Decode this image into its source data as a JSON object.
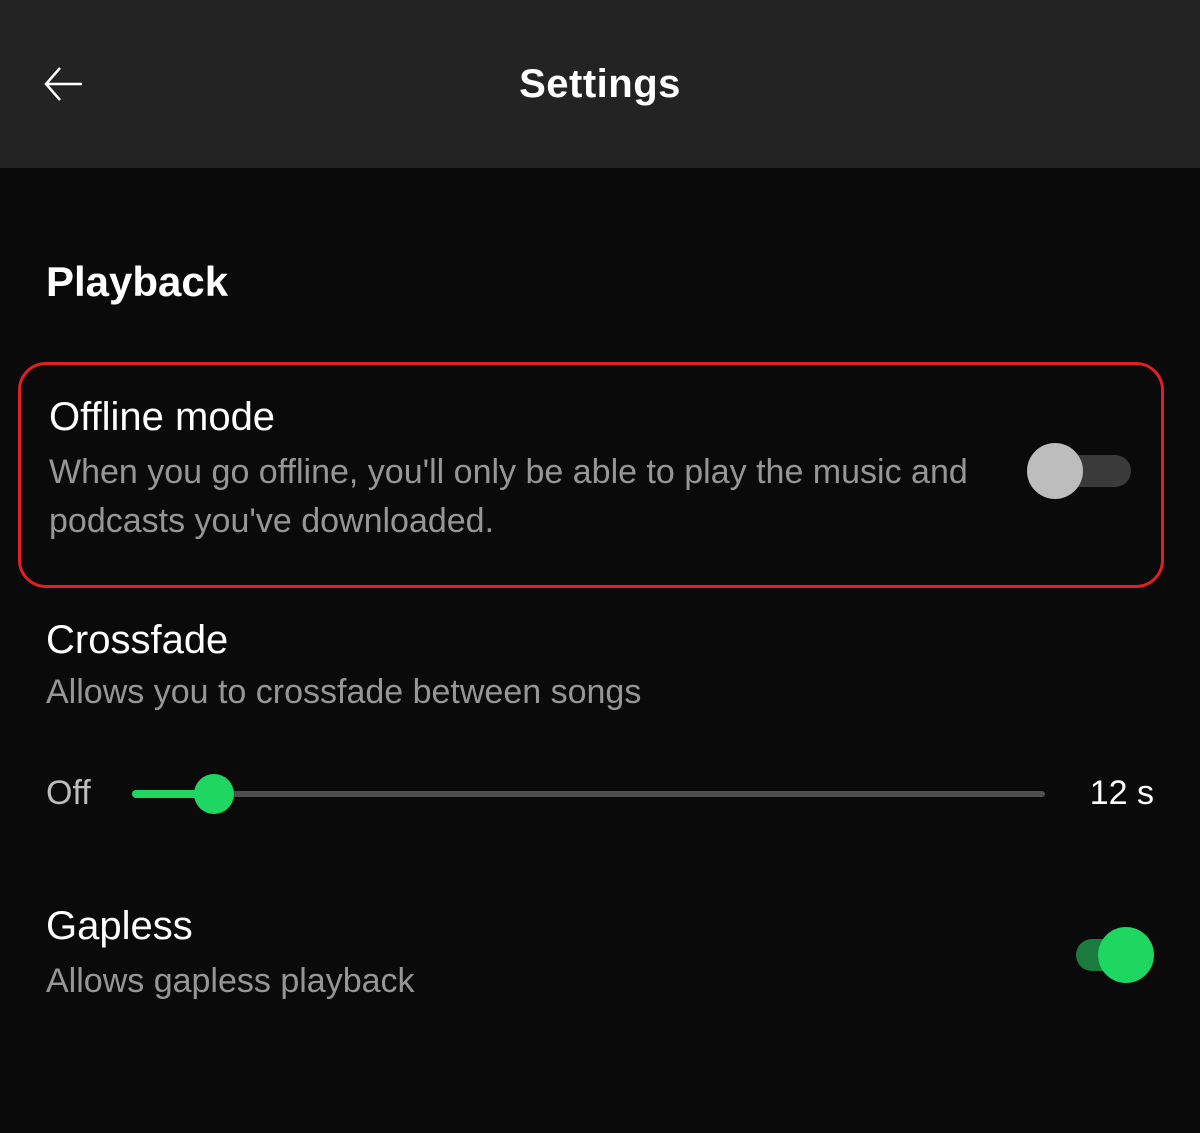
{
  "header": {
    "title": "Settings"
  },
  "section_title": "Playback",
  "offline": {
    "title": "Offline mode",
    "desc": "When you go offline, you'll only be able to play the music and podcasts you've downloaded.",
    "enabled": false
  },
  "crossfade": {
    "title": "Crossfade",
    "desc": "Allows you to crossfade between songs",
    "left_label": "Off",
    "right_label": "12 s",
    "value_percent": 9
  },
  "gapless": {
    "title": "Gapless",
    "desc": "Allows gapless playback",
    "enabled": true
  },
  "colors": {
    "accent": "#1ed760",
    "highlight_border": "#e32020"
  }
}
